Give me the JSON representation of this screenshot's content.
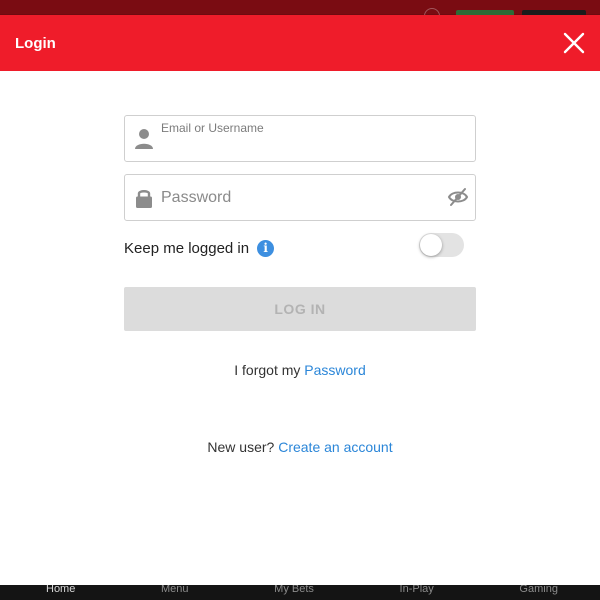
{
  "modal": {
    "title": "Login",
    "header_color": "#ef1c2a"
  },
  "email_field": {
    "label": "Email or Username",
    "value": "",
    "icon": "user-icon"
  },
  "password_field": {
    "placeholder": "Password",
    "value": "",
    "icon": "lock-icon",
    "visibility_icon": "eye-hidden-icon"
  },
  "keep_logged_in": {
    "label": "Keep me logged in",
    "info_glyph": "i",
    "enabled": false
  },
  "login_button": {
    "label": "LOG IN",
    "enabled": false
  },
  "forgot": {
    "text": "I forgot my",
    "link": "Password"
  },
  "signup": {
    "text": "New user?",
    "link": "Create an account",
    "link_color": "#2b86d8"
  },
  "background": {
    "bottom_nav": [
      "Home",
      "Menu",
      "My Bets",
      "In-Play",
      "Gaming"
    ]
  }
}
